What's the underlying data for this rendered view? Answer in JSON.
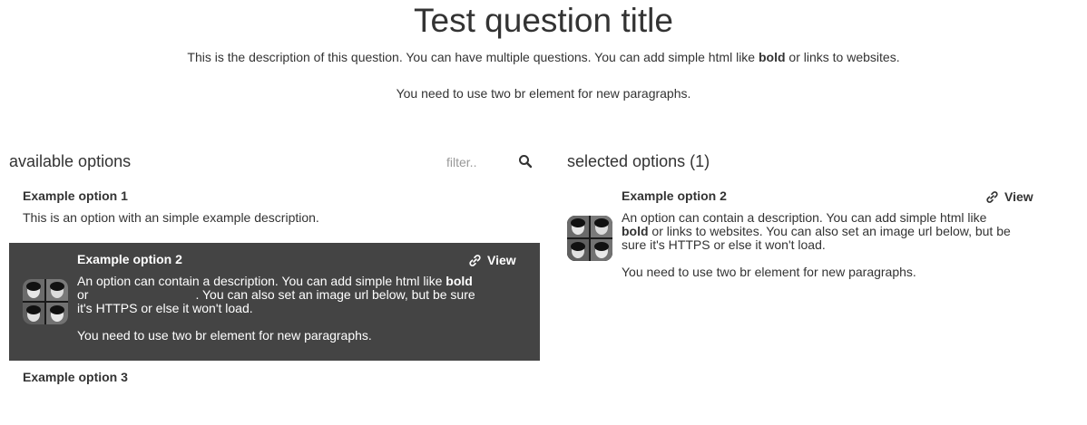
{
  "question": {
    "title": "Test question title",
    "description_line1_a": "This is the description of this question. You can have multiple questions. You can add simple html like ",
    "description_line1_bold": "bold",
    "description_line1_b": " or links to websites.",
    "description_line2": "You need to use two br element for new paragraphs."
  },
  "available": {
    "title": "available options",
    "filter_placeholder": "filter..",
    "search_icon": "search-icon",
    "options": [
      {
        "name": "Example option 1",
        "description": "This is an option with an simple example description."
      },
      {
        "name": "Example option 2",
        "view_label": "View",
        "link_icon": "link-icon",
        "desc_a": "An option can contain a description. You can add simple html like ",
        "desc_bold": "bold",
        "desc_or": "or",
        "desc_b": ". You can also set an image url below, but be sure it's HTTPS or else it won't load.",
        "desc_p2": "You need to use two br element for new paragraphs.",
        "highlighted": true
      },
      {
        "name": "Example option 3"
      }
    ]
  },
  "selected": {
    "title": "selected options (1)",
    "options": [
      {
        "name": "Example option 2",
        "view_label": "View",
        "link_icon": "link-icon",
        "desc_a": "An option can contain a description. You can add simple html like ",
        "desc_bold": "bold",
        "desc_b": " or links to websites. You can also set an image url below, but be sure it's HTTPS or else it won't load.",
        "desc_p2": "You need to use two br element for new paragraphs."
      }
    ]
  },
  "colors": {
    "highlight_bg": "#444444",
    "text": "#333333"
  }
}
